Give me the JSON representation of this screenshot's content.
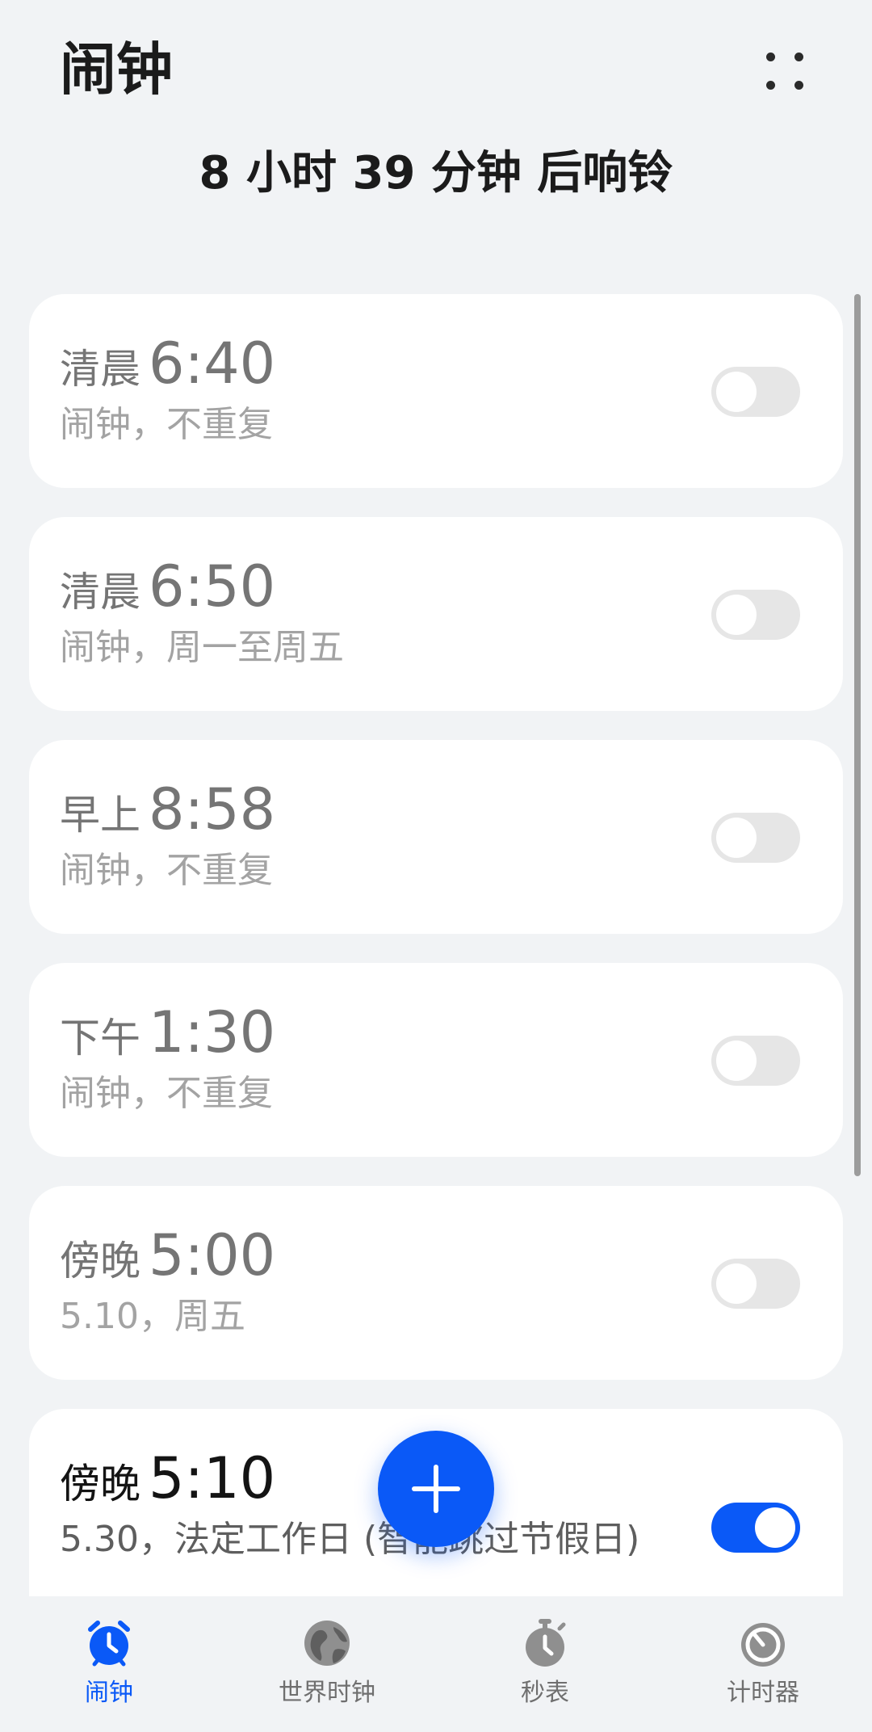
{
  "header": {
    "title": "闹钟",
    "next_ring": "8 小时 39 分钟 后响铃"
  },
  "alarms": [
    {
      "period": "清晨",
      "time": "6:40",
      "subtitle": "闹钟，不重复",
      "enabled": false
    },
    {
      "period": "清晨",
      "time": "6:50",
      "subtitle": "闹钟，周一至周五",
      "enabled": false
    },
    {
      "period": "早上",
      "time": "8:58",
      "subtitle": "闹钟，不重复",
      "enabled": false
    },
    {
      "period": "下午",
      "time": "1:30",
      "subtitle": "闹钟，不重复",
      "enabled": false
    },
    {
      "period": "傍晚",
      "time": "5:00",
      "subtitle": "5.10，周五",
      "enabled": false
    },
    {
      "period": "傍晚",
      "time": "5:10",
      "subtitle": "5.30，法定工作日 (智能跳过节假日)",
      "enabled": true
    }
  ],
  "bottom_nav": [
    {
      "label": "闹钟",
      "icon": "alarm-clock-icon",
      "active": true
    },
    {
      "label": "世界时钟",
      "icon": "globe-icon",
      "active": false
    },
    {
      "label": "秒表",
      "icon": "stopwatch-icon",
      "active": false
    },
    {
      "label": "计时器",
      "icon": "timer-icon",
      "active": false
    }
  ],
  "colors": {
    "accent": "#0a59f7",
    "background": "#f1f3f5",
    "card": "#ffffff",
    "inactive_icon": "#8f8f8f"
  }
}
